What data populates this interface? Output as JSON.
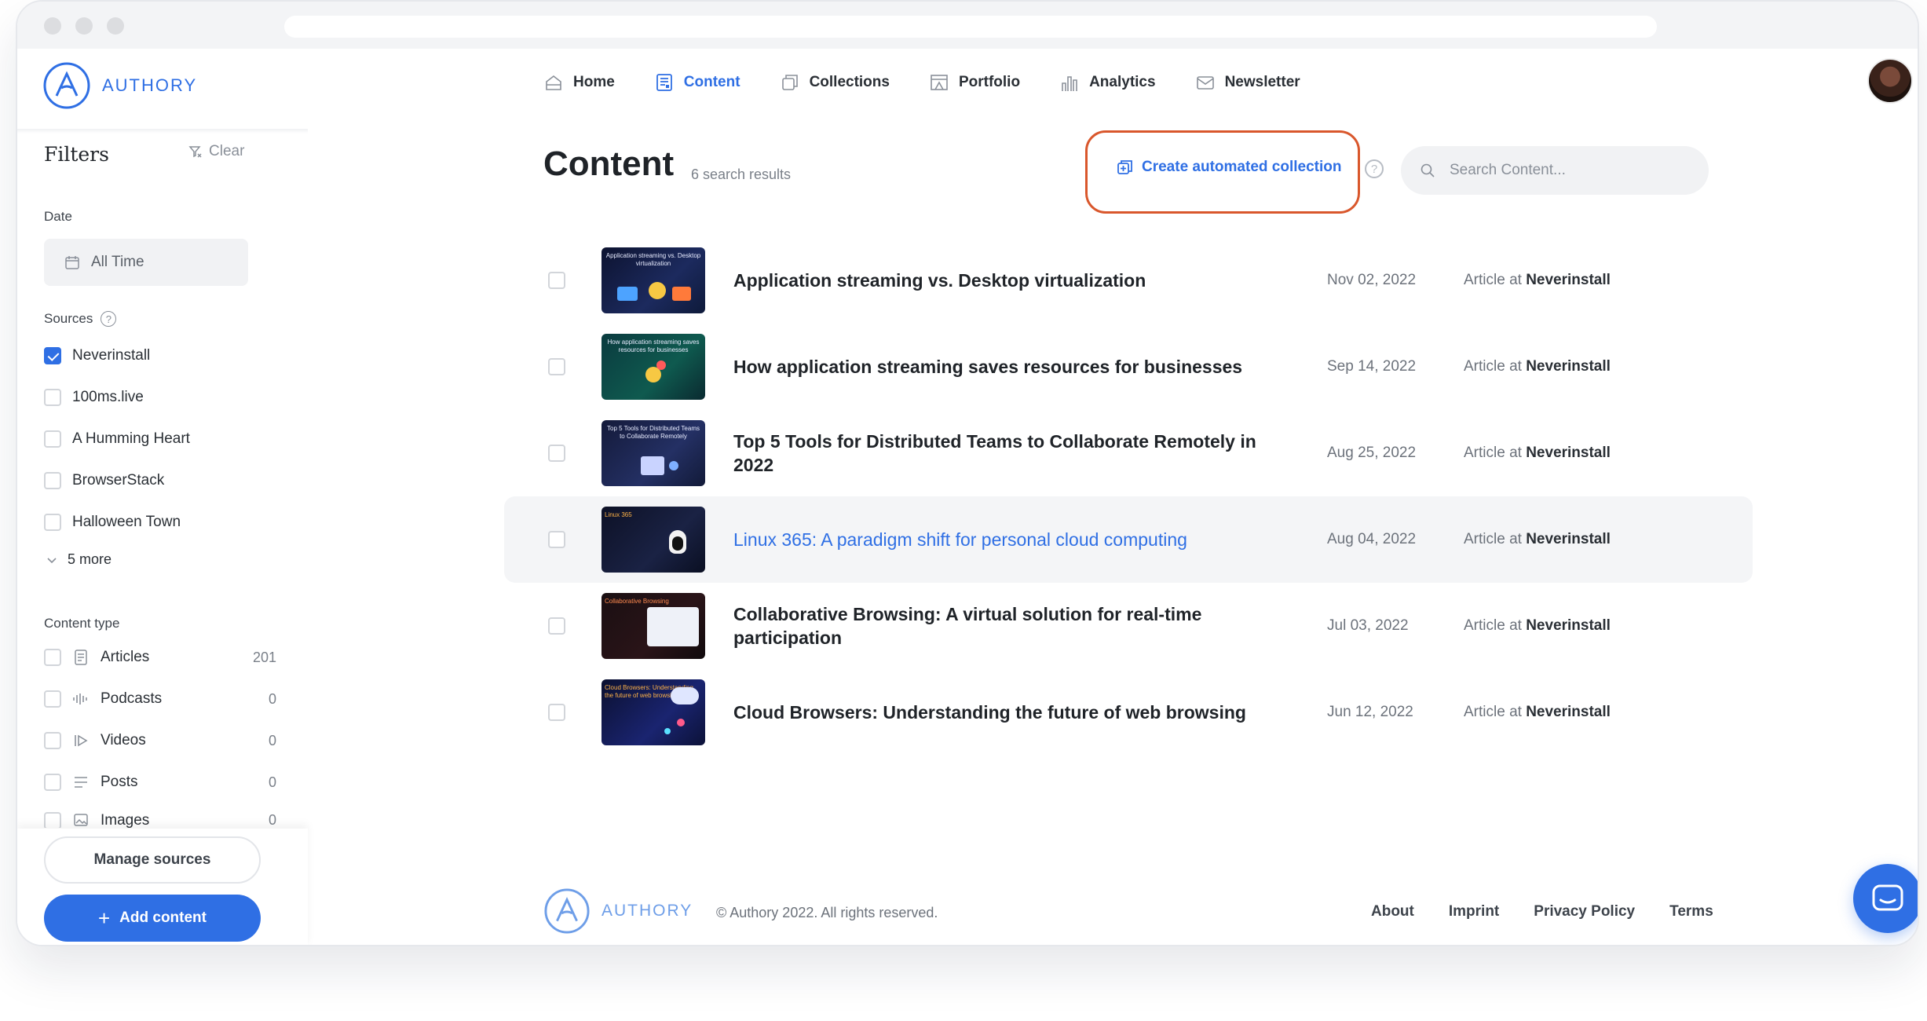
{
  "brand": {
    "name": "AUTHORY",
    "color": "#2f6fe4"
  },
  "nav": [
    {
      "label": "Home",
      "icon": "home-icon"
    },
    {
      "label": "Content",
      "icon": "content-icon",
      "active": true
    },
    {
      "label": "Collections",
      "icon": "collections-icon"
    },
    {
      "label": "Portfolio",
      "icon": "portfolio-icon"
    },
    {
      "label": "Analytics",
      "icon": "analytics-icon"
    },
    {
      "label": "Newsletter",
      "icon": "newsletter-icon"
    }
  ],
  "filters": {
    "title": "Filters",
    "clear_label": "Clear",
    "date_label": "Date",
    "date_value": "All Time",
    "sources_label": "Sources",
    "sources": [
      {
        "label": "Neverinstall",
        "checked": true
      },
      {
        "label": "100ms.live",
        "checked": false
      },
      {
        "label": "A Humming Heart",
        "checked": false
      },
      {
        "label": "BrowserStack",
        "checked": false
      },
      {
        "label": "Halloween Town",
        "checked": false
      }
    ],
    "more_label": "5 more",
    "content_type_label": "Content type",
    "content_types": [
      {
        "label": "Articles",
        "count": "201",
        "icon": "article-icon"
      },
      {
        "label": "Podcasts",
        "count": "0",
        "icon": "podcast-icon"
      },
      {
        "label": "Videos",
        "count": "0",
        "icon": "video-icon"
      },
      {
        "label": "Posts",
        "count": "0",
        "icon": "post-icon"
      },
      {
        "label": "Images",
        "count": "0",
        "icon": "image-icon"
      }
    ]
  },
  "sidebar_actions": {
    "manage_label": "Manage sources",
    "add_label": "Add content"
  },
  "main": {
    "title": "Content",
    "result_count": "6 search results",
    "auto_collection_label": "Create automated collection",
    "search_placeholder": "Search Content...",
    "items": [
      {
        "title": "Application streaming vs. Desktop virtualization",
        "date": "Nov 02, 2022",
        "type": "Article at",
        "source": "Neverinstall",
        "thumb_caption": "Application streaming vs. Desktop virtualization"
      },
      {
        "title": "How application streaming saves resources for businesses",
        "date": "Sep 14, 2022",
        "type": "Article at",
        "source": "Neverinstall",
        "thumb_caption": "How application streaming saves resources for businesses"
      },
      {
        "title": "Top 5 Tools for Distributed Teams to Collaborate Remotely in 2022",
        "date": "Aug 25, 2022",
        "type": "Article at",
        "source": "Neverinstall",
        "thumb_caption": "Top 5 Tools for Distributed Teams to Collaborate Remotely"
      },
      {
        "title": "Linux 365: A paradigm shift for personal cloud computing",
        "date": "Aug 04, 2022",
        "type": "Article at",
        "source": "Neverinstall",
        "thumb_caption": "Linux 365",
        "hover": true
      },
      {
        "title": "Collaborative Browsing: A virtual solution for real-time participation",
        "date": "Jul 03, 2022",
        "type": "Article at",
        "source": "Neverinstall",
        "thumb_caption": "Collaborative Browsing"
      },
      {
        "title": "Cloud Browsers: Understanding the future of web browsing",
        "date": "Jun 12, 2022",
        "type": "Article at",
        "source": "Neverinstall",
        "thumb_caption": "Cloud Browsers: Understanding the future of web browsing"
      }
    ]
  },
  "footer": {
    "copyright": "© Authory 2022. All rights reserved.",
    "links": [
      "About",
      "Imprint",
      "Privacy Policy",
      "Terms"
    ]
  },
  "colors": {
    "accent": "#2f6fe4",
    "highlight": "#d9572c"
  }
}
